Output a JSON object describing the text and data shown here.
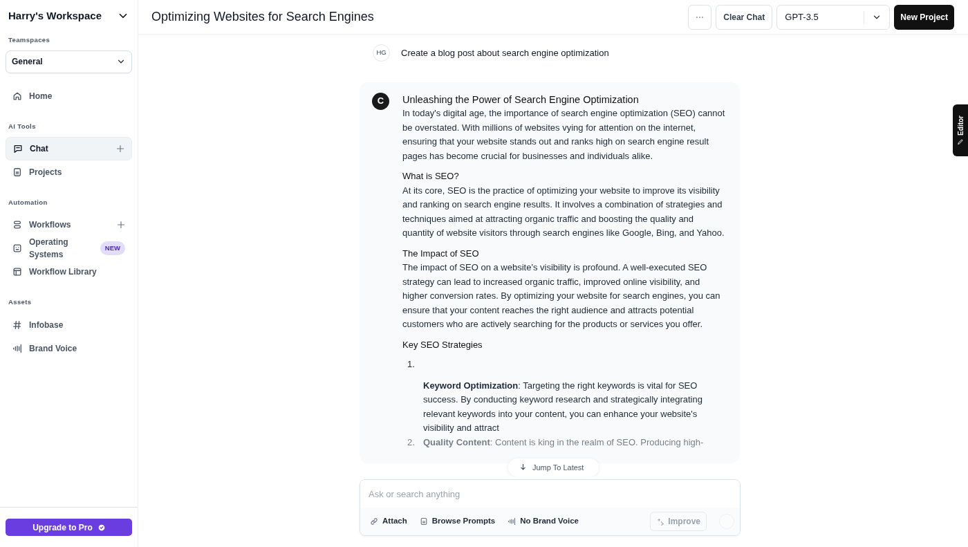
{
  "sidebar": {
    "workspace": "Harry's Workspace",
    "teamspace_label": "Teamspaces",
    "teamspace": "General",
    "sections": [
      {
        "items": [
          {
            "label": "Home",
            "selected": false,
            "addable": false
          }
        ]
      },
      {
        "label": "AI Tools",
        "items": [
          {
            "label": "Chat",
            "selected": true,
            "addable": true
          },
          {
            "label": "Projects",
            "selected": false,
            "addable": false
          }
        ]
      },
      {
        "label": "Automation",
        "items": [
          {
            "label": "Workflows",
            "selected": false,
            "addable": true
          },
          {
            "label": "Operating Systems",
            "selected": false,
            "addable": false,
            "badge": "NEW"
          },
          {
            "label": "Workflow Library",
            "selected": false,
            "addable": false
          }
        ]
      },
      {
        "label": "Assets",
        "items": [
          {
            "label": "Infobase",
            "selected": false,
            "addable": false
          },
          {
            "label": "Brand Voice",
            "selected": false,
            "addable": false
          }
        ]
      }
    ],
    "upgrade": "Upgrade to Pro"
  },
  "header": {
    "title": "Optimizing Websites for Search Engines",
    "more": "···",
    "clear": "Clear Chat",
    "model": "GPT-3.5",
    "new_project": "New Project"
  },
  "messages": [
    {
      "kind": "user",
      "initials": "HG",
      "text": "Create a blog post about search engine optimization"
    },
    {
      "kind": "assistant",
      "avatar": "C",
      "title": "Unleashing the Power of Search Engine Optimization",
      "blocks": [
        {
          "kind": "paragraph",
          "text": "In today's digital age, the importance of search engine optimization (SEO) cannot be overstated. With millions of websites vying for attention on the internet, ensuring that your website stands out and ranks high on search engine result pages has become crucial for businesses and individuals alike."
        },
        {
          "kind": "heading",
          "text": "What is SEO?"
        },
        {
          "kind": "paragraph",
          "text": "At its core, SEO is the practice of optimizing your website to improve its visibility and ranking on search engine results. It involves a combination of strategies and techniques aimed at attracting organic traffic and boosting the quality and quantity of website visitors through search engines like Google, Bing, and Yahoo."
        },
        {
          "kind": "heading",
          "text": "The Impact of SEO"
        },
        {
          "kind": "paragraph",
          "text": "The impact of SEO on a website's visibility is profound. A well-executed SEO strategy can lead to increased organic traffic, improved online visibility, and higher conversion rates. By optimizing your website for search engines, you can ensure that your content reaches the right audience and attracts potential customers who are actively searching for the products or services you offer."
        },
        {
          "kind": "heading",
          "text": "Key SEO Strategies"
        },
        {
          "kind": "list",
          "items": [
            {
              "marker": "1.",
              "text": "**Keyword Optimization**: Targeting the right keywords is vital for SEO success. By conducting keyword research and strategically integrating relevant keywords into your content, you can enhance your website's visibility and attract",
              "stacked": true
            },
            {
              "marker": "2.",
              "text": "**Quality Content**: Content is king in the realm of SEO. Producing high-",
              "stacked": false
            }
          ]
        }
      ]
    }
  ],
  "jump": "Jump To Latest",
  "composer": {
    "placeholder": "Ask or search anything",
    "tools": [
      "Attach",
      "Browse Prompts",
      "No Brand Voice"
    ],
    "improve": {
      "label": "Improve",
      "disabled": true
    }
  },
  "editor_tab": "Editor"
}
